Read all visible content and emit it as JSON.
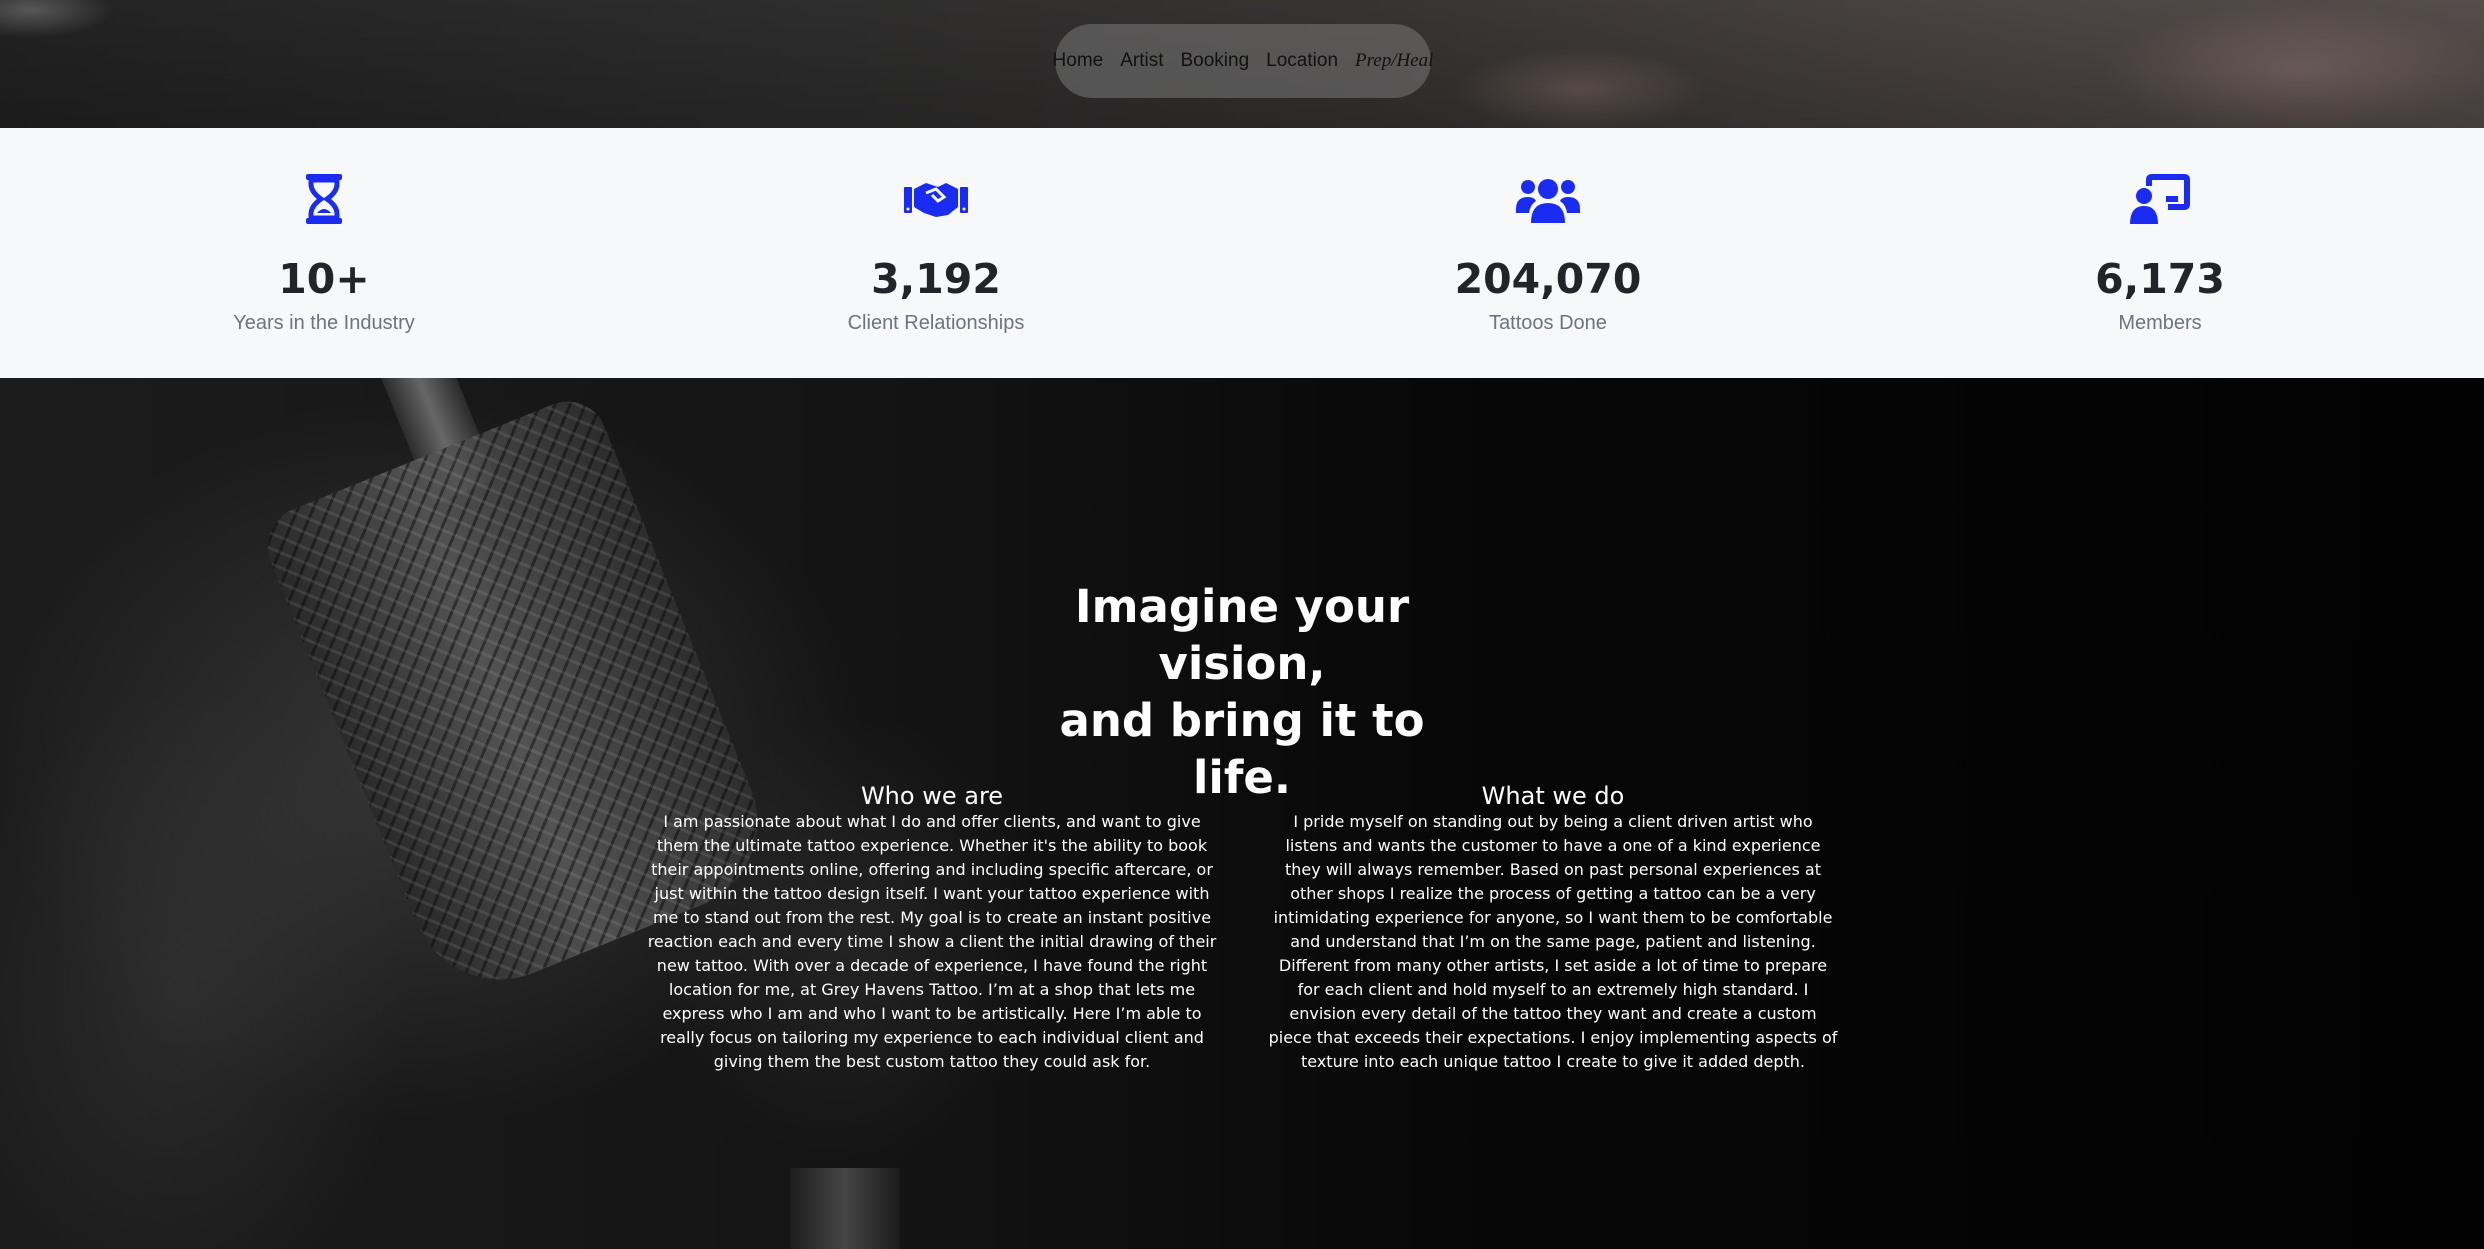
{
  "nav": {
    "items": [
      "Home",
      "Artist",
      "Booking",
      "Location"
    ],
    "script_item": "Prep/Heal"
  },
  "stats": [
    {
      "icon": "hourglass-icon",
      "value": "10+",
      "label": "Years in the Industry"
    },
    {
      "icon": "handshake-icon",
      "value": "3,192",
      "label": "Client Relationships"
    },
    {
      "icon": "users-icon",
      "value": "204,070",
      "label": "Tattoos Done"
    },
    {
      "icon": "chalkboard-user-icon",
      "value": "6,173",
      "label": "Members"
    }
  ],
  "colors": {
    "accent": "#1a2cf2",
    "stat_number": "#212529",
    "stat_label": "#6c757d"
  },
  "about": {
    "headline_lines": [
      "Imagine your vision,",
      "and bring it to",
      "life."
    ],
    "who": {
      "title": "Who we are",
      "body": "I am passionate about what I do and offer clients, and want to give them the ultimate tattoo experience. Whether it's the ability to book their appointments online, offering and including specific aftercare, or just within the tattoo design itself. I want your tattoo experience with me to stand out from the rest. My goal is to create an instant positive reaction each and every time I show a client the initial drawing of their new tattoo. With over a decade of experience, I have found the right location for me, at Grey Havens Tattoo. I’m at a shop that lets me express who I am and who I want to be artistically. Here I’m able to really focus on tailoring my experience to each individual client and giving them the best custom tattoo they could ask for."
    },
    "what": {
      "title": "What we do",
      "body": "I pride myself on standing out by being a client driven artist who listens and wants the customer to have a one of a kind experience they will always remember. Based on past personal experiences at other shops I realize the process of getting a tattoo can be a very intimidating experience for anyone, so I want them to be comfortable and understand that I’m on the same page, patient and listening. Different from many other artists, I set aside a lot of time to prepare for each client and hold myself to an extremely high standard. I envision every detail of the tattoo they want and create a custom piece that exceeds their expectations. I enjoy implementing aspects of texture into each unique tattoo I create to give it added depth."
    }
  }
}
